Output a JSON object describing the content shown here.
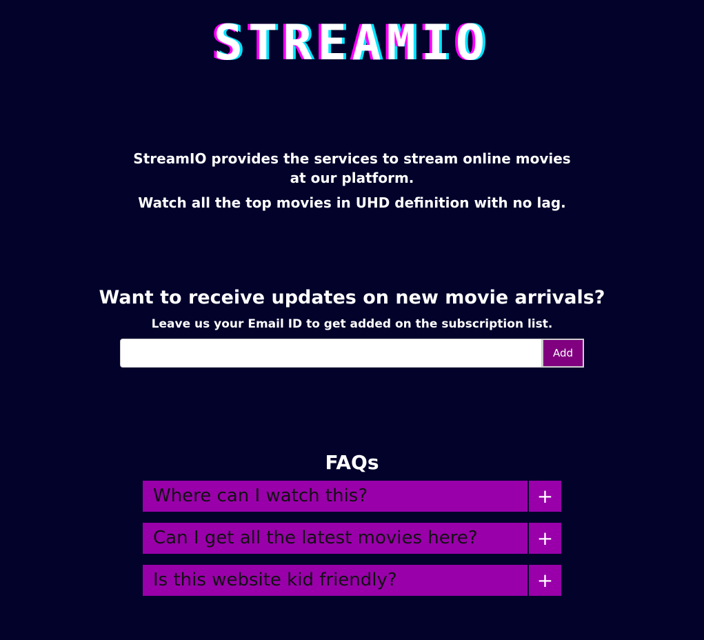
{
  "header": {
    "logo_text": "STREAMIO"
  },
  "intro": {
    "line1": "StreamIO provides the services to stream online movies at our platform.",
    "line2": "Watch all the top movies in UHD definition with no lag."
  },
  "subscribe": {
    "title": "Want to receive updates on new movie arrivals?",
    "subtitle": "Leave us your Email ID to get added on the subscription list.",
    "email_value": "",
    "add_label": "Add"
  },
  "faq": {
    "title": "FAQs",
    "items": [
      {
        "question": "Where can I watch this?",
        "toggle": "+"
      },
      {
        "question": "Can I get all the latest movies here?",
        "toggle": "+"
      },
      {
        "question": "Is this website kid friendly?",
        "toggle": "+"
      }
    ]
  },
  "colors": {
    "background": "#02022b",
    "faq_background": "#9900aa",
    "button_background": "#800080",
    "logo_shadow_left": "#ff00ff",
    "logo_shadow_right": "#00e5ff"
  }
}
